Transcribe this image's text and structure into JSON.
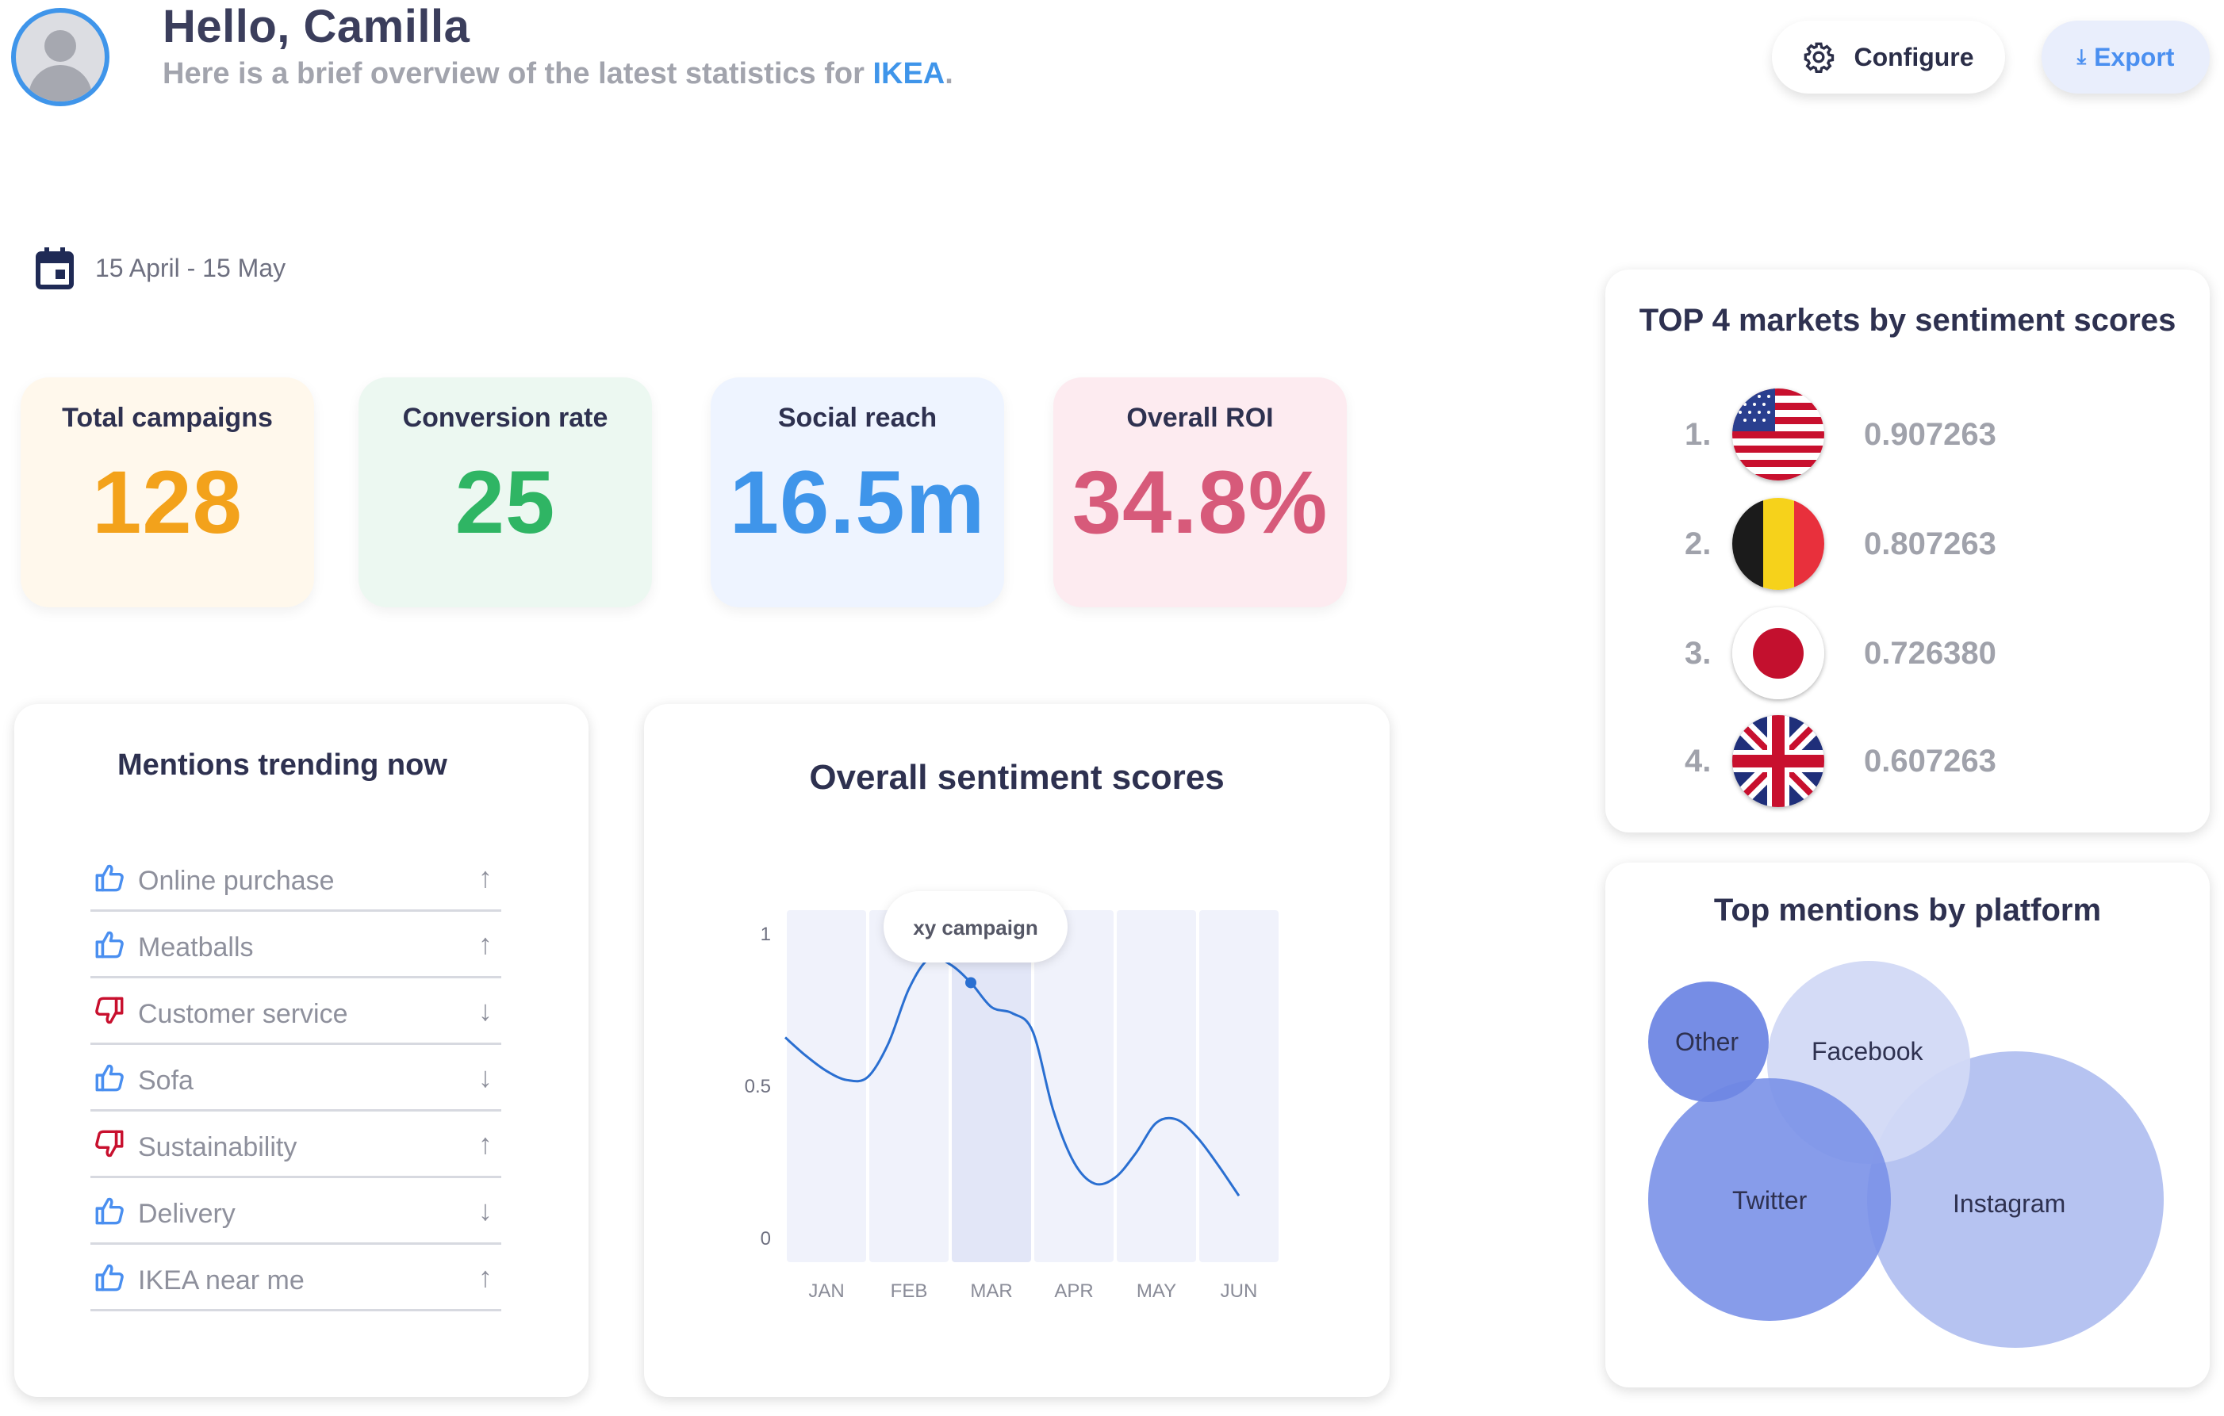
{
  "header": {
    "greeting": "Hello, Camilla",
    "subtitle_prefix": "Here is a brief overview of the latest statistics for ",
    "brand": "IKEA",
    "subtitle_suffix": ".",
    "configure_label": "Configure",
    "export_label": "Export"
  },
  "date_range": "15 April - 15 May",
  "kpis": [
    {
      "label": "Total campaigns",
      "value": "128"
    },
    {
      "label": "Conversion rate",
      "value": "25"
    },
    {
      "label": "Social reach",
      "value": "16.5m"
    },
    {
      "label": "Overall ROI",
      "value": "34.8%"
    }
  ],
  "mentions": {
    "title": "Mentions trending now",
    "items": [
      {
        "label": "Online purchase",
        "sentiment": "positive",
        "trend": "up"
      },
      {
        "label": "Meatballs",
        "sentiment": "positive",
        "trend": "up"
      },
      {
        "label": "Customer service",
        "sentiment": "negative",
        "trend": "down"
      },
      {
        "label": "Sofa",
        "sentiment": "positive",
        "trend": "down"
      },
      {
        "label": "Sustainability",
        "sentiment": "negative",
        "trend": "up"
      },
      {
        "label": "Delivery",
        "sentiment": "positive",
        "trend": "down"
      },
      {
        "label": "IKEA near me",
        "sentiment": "positive",
        "trend": "up"
      }
    ]
  },
  "sentiment_chart": {
    "title": "Overall sentiment scores",
    "tooltip": "xy campaign",
    "highlight_category": "MAR"
  },
  "chart_data": {
    "type": "line",
    "title": "Overall sentiment scores",
    "categories": [
      "JAN",
      "FEB",
      "MAR",
      "APR",
      "MAY",
      "JUN"
    ],
    "x": [
      0,
      0.25,
      0.5,
      0.75,
      1,
      1.25,
      1.5,
      1.75,
      2,
      2.25,
      2.5,
      2.75,
      3,
      3.25,
      3.5,
      3.75,
      4,
      4.25,
      4.5,
      4.75,
      5,
      5.25,
      5.5
    ],
    "series": [
      {
        "values": [
          0.66,
          0.6,
          0.55,
          0.52,
          0.53,
          0.64,
          0.82,
          0.92,
          0.9,
          0.84,
          0.76,
          0.74,
          0.68,
          0.42,
          0.25,
          0.18,
          0.2,
          0.28,
          0.38,
          0.39,
          0.33,
          0.24,
          0.14
        ]
      }
    ],
    "highlight_point": {
      "x": 2.25,
      "y": 0.84
    },
    "yticks": [
      "0",
      "0.5",
      "1"
    ],
    "ylim": [
      0,
      1
    ],
    "grid": false
  },
  "markets": {
    "title": "TOP 4 markets by sentiment scores",
    "items": [
      {
        "rank": "1.",
        "country": "us-flag",
        "score": "0.907263"
      },
      {
        "rank": "2.",
        "country": "belgium-flag",
        "score": "0.807263"
      },
      {
        "rank": "3.",
        "country": "japan-flag",
        "score": "0.726380"
      },
      {
        "rank": "4.",
        "country": "uk-flag",
        "score": "0.607263"
      }
    ]
  },
  "platforms": {
    "title": "Top mentions by platform",
    "bubbles": [
      {
        "label": "Other",
        "color": "#6f87e4"
      },
      {
        "label": "Facebook",
        "color": "#d2d9f6"
      },
      {
        "label": "Twitter",
        "color": "#7a91e8"
      },
      {
        "label": "Instagram",
        "color": "#b6c3f1"
      }
    ]
  },
  "colors": {
    "accent_blue": "#3f95ea",
    "positive_icon": "#4a8ff0",
    "negative_icon": "#c8102e"
  }
}
